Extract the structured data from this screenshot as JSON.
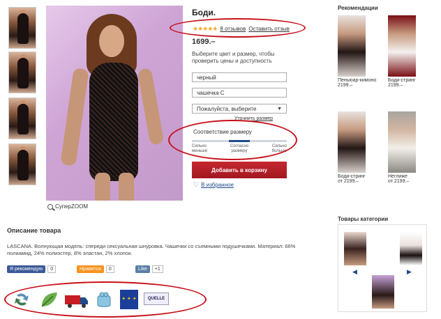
{
  "product": {
    "title": "Боди.",
    "stars": "★★★★★",
    "reviews_link": "8 отзывов",
    "write_review_link": "Оставить отзыв",
    "price": "1699.–",
    "hint": "Выберите цвет и размер, чтобы проверить цены и доступность",
    "color_value": "черный",
    "cup_value": "чашечка С",
    "size_select": "Пожалуйста, выберите",
    "size_table_link": "Уточнить размер",
    "fit": {
      "title": "Соответствие размеру",
      "low": "Сильно меньше",
      "mid": "Согласно размеру",
      "high": "Сильно больше",
      "level": 0.5
    },
    "add_to_cart": "Добавить в корзину",
    "wishlist": "В избранное",
    "zoom_label": "СуперZOOM"
  },
  "description": {
    "title": "Описание товара",
    "text": "LASCANA. Волнующая модель: спереди сексуальная шнуровка. Чашечки со съемными подушечками. Материал: 66% полиамид, 24% полиэстер, 8% эластан, 2% хлопок."
  },
  "social": {
    "fb_label": "Я рекомендую",
    "fb_count": "0",
    "ok_label": "Нравится",
    "ok_count": "0",
    "vk_label": "Like",
    "vk_count": "+1"
  },
  "recommendations": {
    "title": "Рекомендации",
    "items": [
      {
        "name": "Пеньюар-кимоно",
        "price": "2199.–"
      },
      {
        "name": "Боди-стринг",
        "price": "2199.–"
      },
      {
        "name": "Боди-стринг",
        "price": "от 2199.–"
      },
      {
        "name": "Неглиже",
        "price": "от 2199.–"
      }
    ]
  },
  "category": {
    "title": "Товары категории"
  },
  "badges": {
    "quelle": "QUELLE"
  },
  "colors": {
    "accent_red": "#c5282f",
    "link_blue": "#1f4b8a",
    "highlight_ellipse": "#c8101a"
  }
}
